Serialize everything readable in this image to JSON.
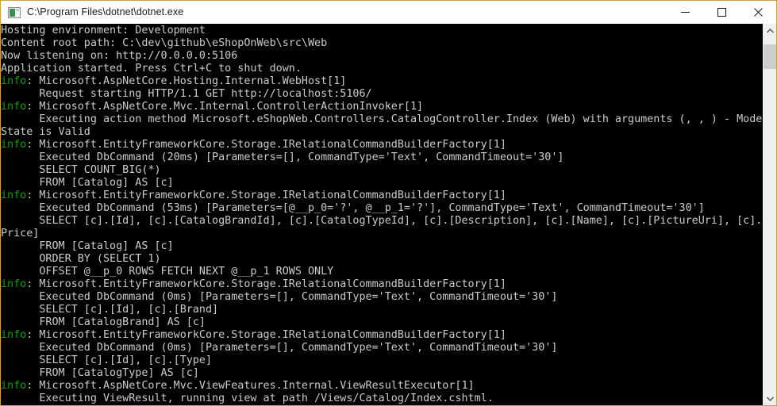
{
  "window": {
    "title": "C:\\Program Files\\dotnet\\dotnet.exe",
    "icon": "console-app-icon",
    "border_color": "#c9a23c",
    "titlebar_bg": "#ffffff",
    "console_bg": "#000000",
    "console_fg": "#cccccc",
    "info_color": "#13a10e"
  },
  "controls": {
    "minimize_label": "Minimize",
    "maximize_label": "Maximize",
    "close_label": "Close"
  },
  "scrollbar": {
    "up_arrow": "▲",
    "down_arrow": "▼",
    "thumb_position_percent": 2,
    "thumb_size_percent": 7
  },
  "console": {
    "lines": [
      [
        {
          "t": "plain",
          "s": "Hosting environment: Development"
        }
      ],
      [
        {
          "t": "plain",
          "s": "Content root path: C:\\dev\\github\\eShopOnWeb\\src\\Web"
        }
      ],
      [
        {
          "t": "plain",
          "s": "Now listening on: http://0.0.0.0:5106"
        }
      ],
      [
        {
          "t": "plain",
          "s": "Application started. Press Ctrl+C to shut down."
        }
      ],
      [
        {
          "t": "info",
          "s": "info"
        },
        {
          "t": "plain",
          "s": ": Microsoft.AspNetCore.Hosting.Internal.WebHost[1]"
        }
      ],
      [
        {
          "t": "plain",
          "s": "      Request starting HTTP/1.1 GET http://localhost:5106/"
        }
      ],
      [
        {
          "t": "info",
          "s": "info"
        },
        {
          "t": "plain",
          "s": ": Microsoft.AspNetCore.Mvc.Internal.ControllerActionInvoker[1]"
        }
      ],
      [
        {
          "t": "plain",
          "s": "      Executing action method Microsoft.eShopWeb.Controllers.CatalogController.Index (Web) with arguments (, , ) - Model"
        }
      ],
      [
        {
          "t": "plain",
          "s": "State is Valid"
        }
      ],
      [
        {
          "t": "info",
          "s": "info"
        },
        {
          "t": "plain",
          "s": ": Microsoft.EntityFrameworkCore.Storage.IRelationalCommandBuilderFactory[1]"
        }
      ],
      [
        {
          "t": "plain",
          "s": "      Executed DbCommand (20ms) [Parameters=[], CommandType='Text', CommandTimeout='30']"
        }
      ],
      [
        {
          "t": "plain",
          "s": "      SELECT COUNT_BIG(*)"
        }
      ],
      [
        {
          "t": "plain",
          "s": "      FROM [Catalog] AS [c]"
        }
      ],
      [
        {
          "t": "info",
          "s": "info"
        },
        {
          "t": "plain",
          "s": ": Microsoft.EntityFrameworkCore.Storage.IRelationalCommandBuilderFactory[1]"
        }
      ],
      [
        {
          "t": "plain",
          "s": "      Executed DbCommand (53ms) [Parameters=[@__p_0='?', @__p_1='?'], CommandType='Text', CommandTimeout='30']"
        }
      ],
      [
        {
          "t": "plain",
          "s": "      SELECT [c].[Id], [c].[CatalogBrandId], [c].[CatalogTypeId], [c].[Description], [c].[Name], [c].[PictureUri], [c].["
        }
      ],
      [
        {
          "t": "plain",
          "s": "Price]"
        }
      ],
      [
        {
          "t": "plain",
          "s": "      FROM [Catalog] AS [c]"
        }
      ],
      [
        {
          "t": "plain",
          "s": "      ORDER BY (SELECT 1)"
        }
      ],
      [
        {
          "t": "plain",
          "s": "      OFFSET @__p_0 ROWS FETCH NEXT @__p_1 ROWS ONLY"
        }
      ],
      [
        {
          "t": "info",
          "s": "info"
        },
        {
          "t": "plain",
          "s": ": Microsoft.EntityFrameworkCore.Storage.IRelationalCommandBuilderFactory[1]"
        }
      ],
      [
        {
          "t": "plain",
          "s": "      Executed DbCommand (0ms) [Parameters=[], CommandType='Text', CommandTimeout='30']"
        }
      ],
      [
        {
          "t": "plain",
          "s": "      SELECT [c].[Id], [c].[Brand]"
        }
      ],
      [
        {
          "t": "plain",
          "s": "      FROM [CatalogBrand] AS [c]"
        }
      ],
      [
        {
          "t": "info",
          "s": "info"
        },
        {
          "t": "plain",
          "s": ": Microsoft.EntityFrameworkCore.Storage.IRelationalCommandBuilderFactory[1]"
        }
      ],
      [
        {
          "t": "plain",
          "s": "      Executed DbCommand (0ms) [Parameters=[], CommandType='Text', CommandTimeout='30']"
        }
      ],
      [
        {
          "t": "plain",
          "s": "      SELECT [c].[Id], [c].[Type]"
        }
      ],
      [
        {
          "t": "plain",
          "s": "      FROM [CatalogType] AS [c]"
        }
      ],
      [
        {
          "t": "info",
          "s": "info"
        },
        {
          "t": "plain",
          "s": ": Microsoft.AspNetCore.Mvc.ViewFeatures.Internal.ViewResultExecutor[1]"
        }
      ],
      [
        {
          "t": "plain",
          "s": "      Executing ViewResult, running view at path /Views/Catalog/Index.cshtml."
        }
      ]
    ]
  }
}
